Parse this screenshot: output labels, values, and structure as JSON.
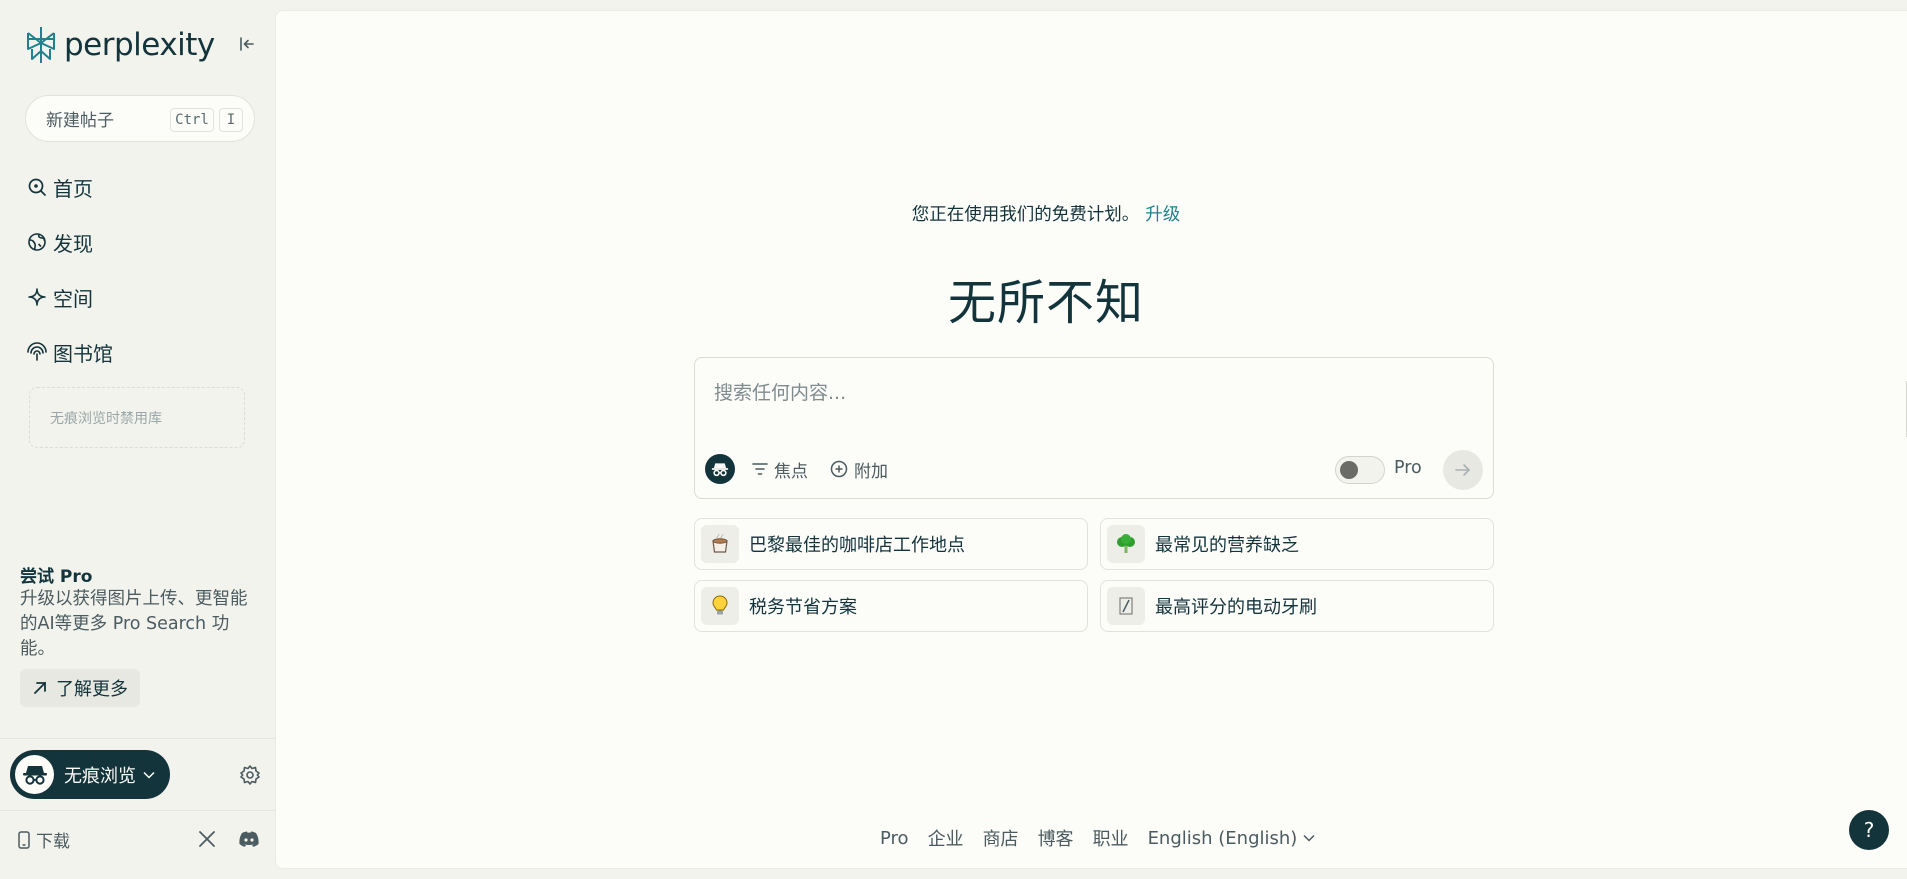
{
  "app": {
    "logo_text": "perplexity"
  },
  "sidebar": {
    "new_thread": {
      "label": "新建帖子",
      "shortcut_key1": "Ctrl",
      "shortcut_key2": "I"
    },
    "nav": [
      {
        "label": "首页",
        "icon": "search-icon"
      },
      {
        "label": "发现",
        "icon": "globe-icon"
      },
      {
        "label": "空间",
        "icon": "sparkle-icon"
      },
      {
        "label": "图书馆",
        "icon": "library-icon"
      }
    ],
    "library_note": "无痕浏览时禁用库",
    "promo": {
      "title": "尝试 Pro",
      "body": "升级以获得图片上传、更智能的AI等更多 Pro Search 功能。",
      "button": "了解更多"
    },
    "incognito": {
      "label": "无痕浏览"
    },
    "download": "下载"
  },
  "main": {
    "plan_text": "您正在使用我们的免费计划。",
    "upgrade_link": "升级",
    "headline": "无所不知",
    "search": {
      "placeholder": "搜索任何内容...",
      "focus_label": "焦点",
      "attach_label": "附加",
      "pro_label": "Pro",
      "pro_enabled": false
    },
    "suggestions": [
      {
        "text": "巴黎最佳的咖啡店工作地点",
        "emoji": "☕"
      },
      {
        "text": "最常见的营养缺乏",
        "emoji": "🥦"
      },
      {
        "text": "税务节省方案",
        "emoji": "💡"
      },
      {
        "text": "最高评分的电动牙刷",
        "emoji": "🪥"
      }
    ],
    "footer": {
      "links": [
        "Pro",
        "企业",
        "商店",
        "博客",
        "职业"
      ],
      "language": "English (English)"
    },
    "help": "?"
  },
  "colors": {
    "sidebar_bg": "#f3f3ee",
    "main_bg": "#fcfcf9",
    "primary": "#13343b",
    "accent": "#20808d"
  }
}
